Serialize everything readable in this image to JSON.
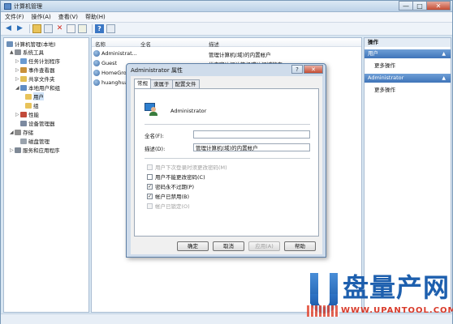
{
  "window": {
    "title": "计算机管理",
    "min_label": "—",
    "max_label": "□",
    "close_label": "✕"
  },
  "menu": [
    "文件(F)",
    "操作(A)",
    "查看(V)",
    "帮助(H)"
  ],
  "tree": {
    "root": "计算机管理(本地)",
    "items": [
      {
        "label": "系统工具",
        "exp": "▲"
      },
      {
        "label": "任务计划程序",
        "exp": "▷"
      },
      {
        "label": "事件查看器",
        "exp": "▷"
      },
      {
        "label": "共享文件夹",
        "exp": "▷"
      },
      {
        "label": "本地用户和组",
        "exp": "◢"
      },
      {
        "label": "用户",
        "exp": ""
      },
      {
        "label": "组",
        "exp": ""
      },
      {
        "label": "性能",
        "exp": "▷"
      },
      {
        "label": "设备管理器",
        "exp": ""
      },
      {
        "label": "存储",
        "exp": "◢"
      },
      {
        "label": "磁盘管理",
        "exp": ""
      },
      {
        "label": "服务和应用程序",
        "exp": "▷"
      }
    ]
  },
  "list": {
    "headers": {
      "name": "名称",
      "fullname": "全名",
      "desc": "描述"
    },
    "rows": [
      {
        "name": "Administrat...",
        "desc": "管理计算机(域)的内置帐户"
      },
      {
        "name": "Guest",
        "desc": "供来宾访问计算机或访问域的内..."
      },
      {
        "name": "HomeGro...",
        "desc": ""
      },
      {
        "name": "huanghua",
        "desc": ""
      }
    ]
  },
  "actions": {
    "header": "操作",
    "section1": {
      "title": "用户",
      "more": "更多操作"
    },
    "section2": {
      "title": "Administrator",
      "more": "更多操作"
    }
  },
  "dialog": {
    "title": "Administrator 属性",
    "help_label": "?",
    "close_label": "✕",
    "tabs": [
      "常规",
      "隶属于",
      "配置文件"
    ],
    "username": "Administrator",
    "fullname_label": "全名(F):",
    "fullname_value": "",
    "desc_label": "描述(D):",
    "desc_value": "管理计算机(域)的内置帐户",
    "checkboxes": [
      {
        "label": "用户下次登录时须更改密码(M)",
        "checked": false,
        "disabled": true
      },
      {
        "label": "用户不能更改密码(C)",
        "checked": false,
        "disabled": false
      },
      {
        "label": "密码永不过期(P)",
        "checked": true,
        "disabled": false
      },
      {
        "label": "帐户已禁用(B)",
        "checked": true,
        "disabled": false
      },
      {
        "label": "帐户已锁定(O)",
        "checked": false,
        "disabled": true
      }
    ],
    "buttons": {
      "ok": "确定",
      "cancel": "取消",
      "apply": "应用(A)",
      "help": "帮助"
    }
  },
  "watermark": {
    "brand": "盘量产网",
    "url": "WWW.UPANTOOL.COM"
  },
  "colors": {
    "accent": "#3f74b9",
    "watermark_blue": "#1d5fae",
    "watermark_red": "#d83a2a"
  }
}
